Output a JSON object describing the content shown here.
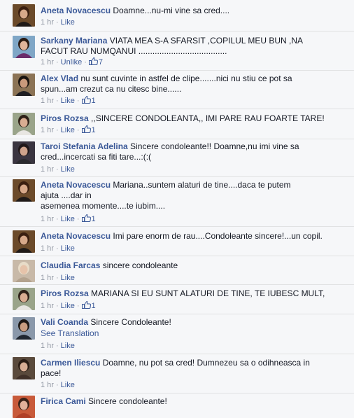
{
  "comments": [
    {
      "author": "Aneta Novacescu",
      "text": "Doamne...nu-mi vine sa cred....",
      "time": "1 hr",
      "action": "Like",
      "likes": "",
      "avatar": "aneta-avatar"
    },
    {
      "author": "Sarkany Mariana",
      "text": "VIATA MEA S-A SFARSIT ,COPILUL MEU BUN ,NA\nFACUT RAU NUMQANUI ......................................",
      "time": "1 hr",
      "action": "Unlike",
      "likes": "7",
      "avatar": "sarkany-avatar"
    },
    {
      "author": "Alex Vlad",
      "text": "nu sunt cuvinte in astfel de clipe.......nici nu stiu ce pot sa\nspun...am crezut ca nu citesc bine......",
      "time": "1 hr",
      "action": "Like",
      "likes": "1",
      "avatar": "alex-avatar"
    },
    {
      "author": "Piros Rozsa",
      "text": ",,SINCERE CONDOLEANTA,, IMI PARE RAU FOARTE TARE!",
      "time": "1 hr",
      "action": "Like",
      "likes": "1",
      "avatar": "piros-avatar"
    },
    {
      "author": "Taroi Stefania Adelina",
      "text": "Sincere condoleante!! Doamne,nu imi vine sa\ncred...incercati sa fiti tare...:(:(",
      "time": "1 hr",
      "action": "Like",
      "likes": "",
      "avatar": "taroi-avatar"
    },
    {
      "author": "Aneta Novacescu",
      "text": "Mariana..suntem alaturi de tine....daca te putem\najuta ....dar in\nasemenea momente....te iubim....",
      "time": "1 hr",
      "action": "Like",
      "likes": "1",
      "avatar": "aneta-avatar"
    },
    {
      "author": "Aneta Novacescu",
      "text": "Imi pare enorm de rau....Condoleante sincere!...un copil.",
      "time": "1 hr",
      "action": "Like",
      "likes": "",
      "avatar": "aneta-avatar"
    },
    {
      "author": "Claudia Farcas",
      "text": "sincere condoleante",
      "time": "1 hr",
      "action": "Like",
      "likes": "",
      "avatar": "claudia-avatar"
    },
    {
      "author": "Piros Rozsa",
      "text": "MARIANA SI EU SUNT ALATURI DE TINE, TE IUBESC MULT,",
      "time": "1 hr",
      "action": "Like",
      "likes": "1",
      "avatar": "piros-avatar"
    },
    {
      "author": "Vali Coanda",
      "text": "Sincere Condoleante!",
      "see_translation": "See Translation",
      "time": "1 hr",
      "action": "Like",
      "likes": "",
      "avatar": "vali-avatar"
    },
    {
      "author": "Carmen Iliescu",
      "text": "Doamne, nu pot sa cred! Dumnezeu sa o odihneasca in\npace!",
      "time": "1 hr",
      "action": "Like",
      "likes": "",
      "avatar": "carmen-avatar"
    },
    {
      "author": "Firica Cami",
      "text": "Sincere condoleante!",
      "time": "",
      "action": "",
      "likes": "",
      "avatar": "firica-avatar"
    }
  ],
  "colors": {
    "link": "#3b5998",
    "meta": "#9197a3",
    "text": "#141823",
    "background": "#f6f7f9",
    "divider": "#e1e2e3"
  }
}
